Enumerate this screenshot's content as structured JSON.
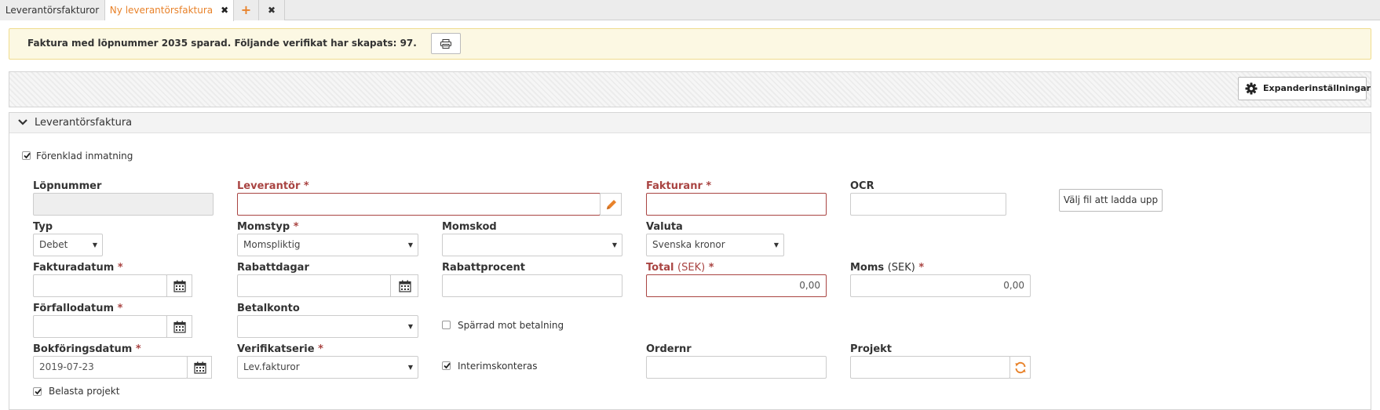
{
  "tabs": [
    {
      "label": "Leverantörsfakturor"
    },
    {
      "label": "Ny leverantörsfaktura",
      "close": "✖"
    }
  ],
  "tab_add": "+",
  "tab_close_all": "✖",
  "notice": {
    "text": "Faktura med löpnummer 2035 sparad. Följande verifikat har skapats: 97.",
    "print_icon": "print-icon"
  },
  "toolbar": {
    "expand_label": "Expanderinställningar",
    "icon": "gear-icon"
  },
  "section": {
    "title": "Leverantörsfaktura"
  },
  "form": {
    "forenklad": {
      "label": "Förenklad inmatning",
      "checked": true
    },
    "lopnummer": {
      "label": "Löpnummer",
      "value": ""
    },
    "leverantor": {
      "label": "Leverantör",
      "required": "*",
      "value": ""
    },
    "fakturanr": {
      "label": "Fakturanr",
      "required": "*",
      "value": ""
    },
    "ocr": {
      "label": "OCR",
      "value": ""
    },
    "file_button": "Välj fil att ladda upp",
    "typ": {
      "label": "Typ",
      "value": "Debet"
    },
    "momstyp": {
      "label": "Momstyp",
      "required": "*",
      "value": "Momspliktig"
    },
    "momskod": {
      "label": "Momskod",
      "value": ""
    },
    "valuta": {
      "label": "Valuta",
      "value": "Svenska kronor"
    },
    "fakturadatum": {
      "label": "Fakturadatum",
      "required": "*",
      "value": ""
    },
    "rabattdagar": {
      "label": "Rabattdagar",
      "value": ""
    },
    "rabattprocent": {
      "label": "Rabattprocent",
      "value": ""
    },
    "total": {
      "label": "Total",
      "unit": "(SEK)",
      "required": "*",
      "value": "0,00"
    },
    "moms": {
      "label": "Moms",
      "unit": "(SEK)",
      "required": "*",
      "value": "0,00"
    },
    "forfallodatum": {
      "label": "Förfallodatum",
      "required": "*",
      "value": ""
    },
    "betalkonto": {
      "label": "Betalkonto",
      "value": ""
    },
    "sparrad": {
      "label": "Spärrad mot betalning",
      "checked": false
    },
    "bokforingsdatum": {
      "label": "Bokföringsdatum",
      "required": "*",
      "value": "2019-07-23"
    },
    "verifikatserie": {
      "label": "Verifikatserie",
      "required": "*",
      "value": "Lev.fakturor"
    },
    "interimskonteras": {
      "label": "Interimskonteras",
      "checked": true
    },
    "ordernr": {
      "label": "Ordernr",
      "value": ""
    },
    "projekt": {
      "label": "Projekt",
      "value": ""
    },
    "belasta": {
      "label": "Belasta projekt",
      "checked": true
    }
  },
  "colors": {
    "accent": "#e8822a",
    "error": "#a94442",
    "notice_bg": "#fcf8e3"
  }
}
